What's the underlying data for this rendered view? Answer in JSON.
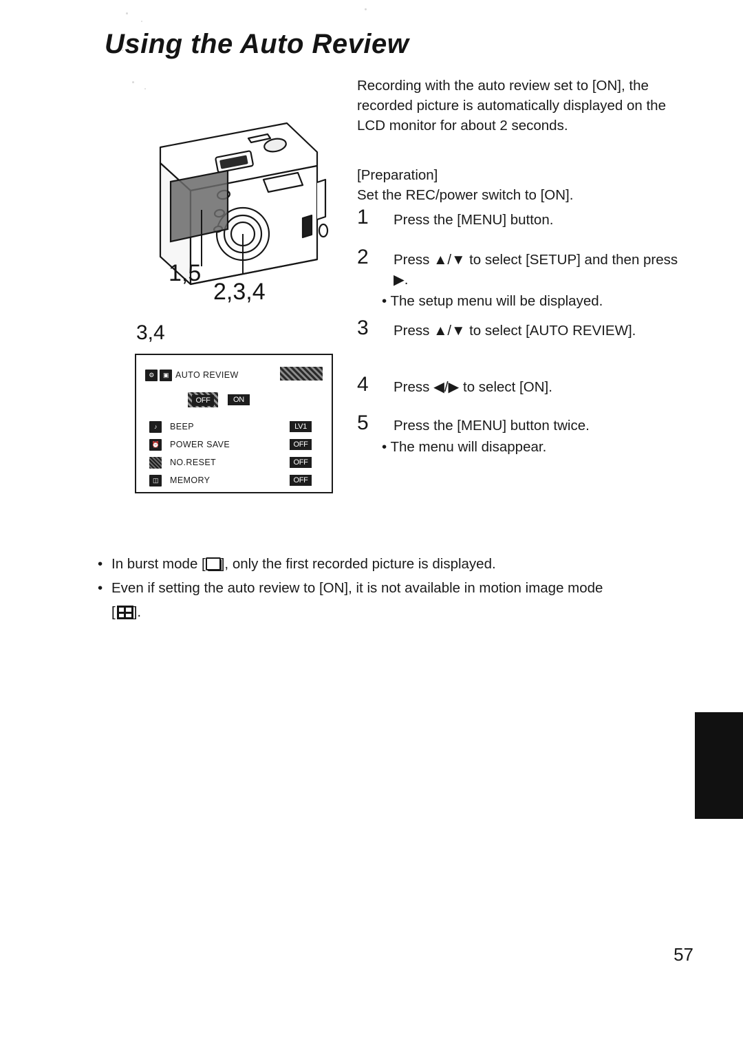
{
  "page": {
    "title": "Using the Auto Review",
    "number": "57"
  },
  "intro": "Recording with the auto review set to [ON], the recorded picture is automatically displayed on the LCD monitor for about 2 seconds.",
  "preparation": {
    "heading": "[Preparation]",
    "text": "Set the REC/power switch to [ON]."
  },
  "steps": [
    {
      "num": "1",
      "text": "Press the [MENU] button.",
      "sub": ""
    },
    {
      "num": "2",
      "text": "Press ▲/▼ to select [SETUP] and then press ▶.",
      "sub": "• The setup menu will be displayed."
    },
    {
      "num": "3",
      "text": "Press ▲/▼ to select [AUTO REVIEW].",
      "sub": ""
    },
    {
      "num": "4",
      "text": "Press ◀/▶ to select [ON].",
      "sub": ""
    },
    {
      "num": "5",
      "text": "Press the [MENU] button twice.",
      "sub": "• The menu will disappear."
    }
  ],
  "figure": {
    "callout_left": "1,5",
    "callout_right": "2,3,4",
    "callout_lcd": "3,4"
  },
  "lcd_menu": {
    "header_icons": [
      "setup-tab-icon",
      "camera-icon"
    ],
    "header_label": "AUTO REVIEW",
    "toggle": {
      "off_label": "OFF",
      "on_label": "ON",
      "selected": "OFF"
    },
    "rows": [
      {
        "icon": "beep-icon",
        "label": "BEEP",
        "value": "LV1"
      },
      {
        "icon": "power-save-icon",
        "label": "POWER SAVE",
        "value": "OFF"
      },
      {
        "icon": "no-reset-icon",
        "label": "NO.RESET",
        "value": "OFF"
      },
      {
        "icon": "memory-icon",
        "label": "MEMORY",
        "value": "OFF"
      }
    ]
  },
  "notes": [
    {
      "pre": "In burst mode [",
      "icon": "burst-mode-icon",
      "post": "], only the first recorded picture is displayed."
    },
    {
      "pre": "Even if setting the auto review to [ON], it is not available in motion image mode",
      "icon": "motion-image-icon",
      "post": "[",
      "post2": "]."
    }
  ]
}
